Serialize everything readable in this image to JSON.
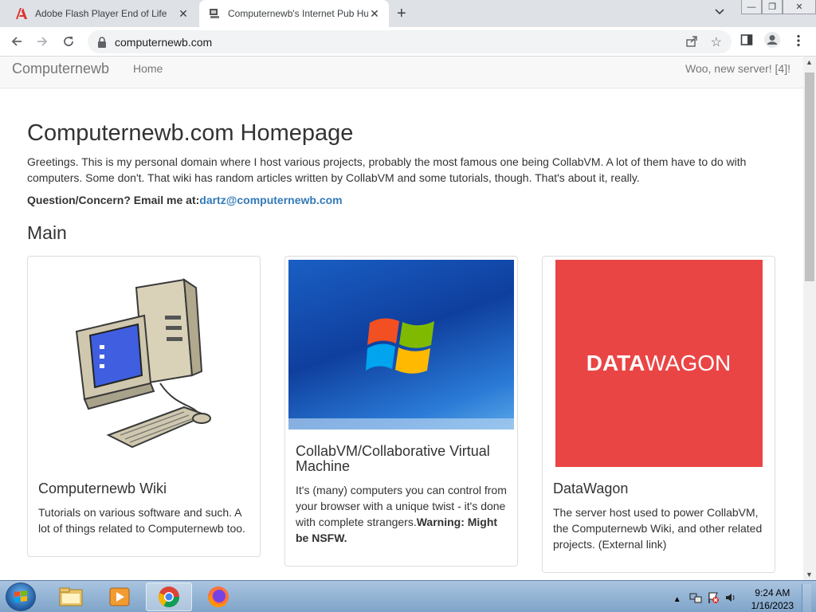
{
  "browser": {
    "tabs": [
      {
        "title": "Adobe Flash Player End of Life"
      },
      {
        "title": "Computernewb's Internet Pub Hub"
      }
    ],
    "url": "computernewb.com"
  },
  "site": {
    "brand": "Computernewb",
    "nav_home": "Home",
    "nav_right": "Woo, new server! [4]!"
  },
  "page": {
    "title": "Computernewb.com Homepage",
    "intro": "Greetings. This is my personal domain where I host various projects, probably the most famous one being CollabVM. A lot of them have to do with computers. Some don't. That wiki has random articles written by CollabVM and some tutorials, though. That's about it, really.",
    "question_label": "Question/Concern? Email me at:",
    "email": "dartz@computernewb.com",
    "section": "Main"
  },
  "cards": [
    {
      "title": "Computernewb Wiki",
      "desc": "Tutorials on various software and such. A lot of things related to Computernewb too."
    },
    {
      "title": "CollabVM/Collaborative Virtual Machine",
      "desc": "It's (many) computers you can control from your browser with a unique twist - it's done with complete strangers.",
      "warning": "Warning: Might be NSFW."
    },
    {
      "title": "DataWagon",
      "desc": "The server host used to power CollabVM, the Computernewb Wiki, and other related projects. (External link)",
      "logo_bold": "DATA",
      "logo_light": "WAGON",
      "logo_bg": "#ea4545"
    }
  ],
  "taskbar": {
    "time": "9:24 AM",
    "date": "1/16/2023"
  }
}
